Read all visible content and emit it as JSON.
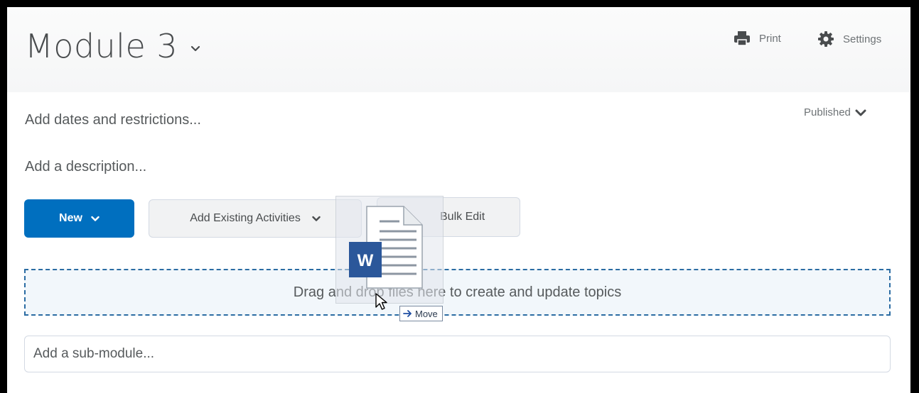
{
  "module": {
    "title": "Module 3"
  },
  "header_actions": {
    "print_label": "Print",
    "settings_label": "Settings"
  },
  "status": {
    "label": "Published"
  },
  "links": {
    "dates": "Add dates and restrictions...",
    "description": "Add a description..."
  },
  "toolbar": {
    "new_label": "New",
    "add_existing_label": "Add Existing Activities",
    "bulk_edit_label": "Bulk Edit"
  },
  "dropzone": {
    "text": "Drag and drop files here to create and update topics"
  },
  "submodule": {
    "placeholder": "Add a sub-module..."
  },
  "drag": {
    "file_badge": "W",
    "tooltip_label": "Move"
  },
  "colors": {
    "primary": "#006fbf",
    "dropzone_border": "#2b6ca3",
    "word_blue": "#2b579a"
  }
}
